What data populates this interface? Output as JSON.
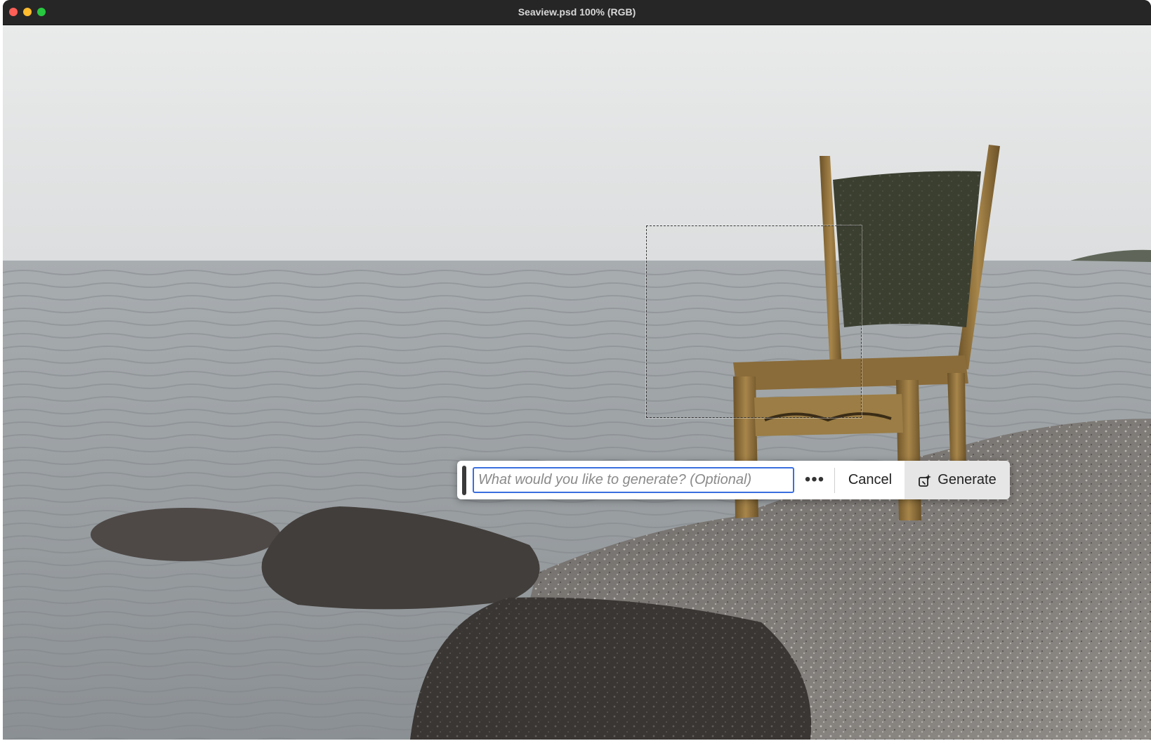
{
  "window": {
    "title": "Seaview.psd 100% (RGB)",
    "buttons": [
      "close",
      "minimize",
      "maximize"
    ]
  },
  "document": {
    "image_subject": "weathered wooden chair on a gravel shore by the sea with rocks in foreground"
  },
  "contextual_taskbar": {
    "prompt_placeholder": "What would you like to generate? (Optional)",
    "prompt_value": "",
    "more_label": "•••",
    "cancel_label": "Cancel",
    "generate_label": "Generate",
    "generate_icon": "generative-fill-icon"
  },
  "colors": {
    "titlebar": "#262626",
    "focus_ring": "#3b6fe0",
    "generate_bg": "#e6e6e6"
  }
}
